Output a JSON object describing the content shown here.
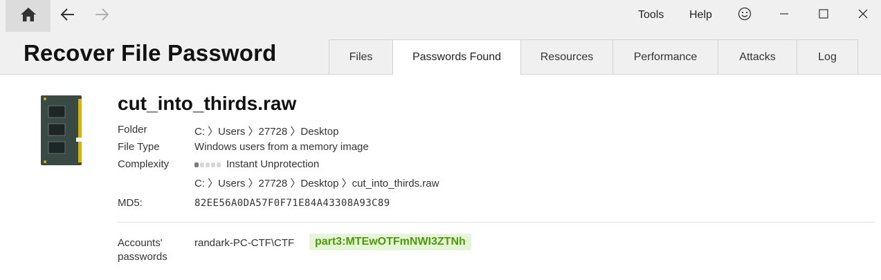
{
  "toolbar": {
    "home_icon": "home-icon",
    "back_icon": "arrow-left-icon",
    "forward_icon": "arrow-right-icon",
    "menu": [
      "Tools",
      "Help"
    ],
    "feedback_icon": "smiley-icon"
  },
  "window": {
    "minimize_icon": "minimize-icon",
    "maximize_icon": "maximize-icon",
    "close_icon": "close-icon"
  },
  "app": {
    "title": "Recover File Password"
  },
  "tabs": [
    {
      "label": "Files",
      "active": false
    },
    {
      "label": "Passwords Found",
      "active": true
    },
    {
      "label": "Resources",
      "active": false
    },
    {
      "label": "Performance",
      "active": false
    },
    {
      "label": "Attacks",
      "active": false
    },
    {
      "label": "Log",
      "active": false
    }
  ],
  "file": {
    "icon": "memory-module-icon",
    "name": "cut_into_thirds.raw",
    "folder_label": "Folder",
    "folder_value": "C: 〉Users 〉27728 〉Desktop",
    "type_label": "File Type",
    "type_value": "Windows users from a memory image",
    "complexity_label": "Complexity",
    "complexity_level": 1,
    "complexity_max": 5,
    "complexity_value": "Instant Unprotection",
    "path_value": "C: 〉Users 〉27728 〉Desktop 〉cut_into_thirds.raw",
    "md5_label": "MD5:",
    "md5_value": "82EE56A0DA57F0F71E84A43308A93C89"
  },
  "accounts": {
    "label_line1": "Accounts'",
    "label_line2": "passwords",
    "account": "randark-PC-CTF\\CTF",
    "password": "part3:MTEwOTFmNWI3ZTNh",
    "password_color": "#4e9a06"
  }
}
